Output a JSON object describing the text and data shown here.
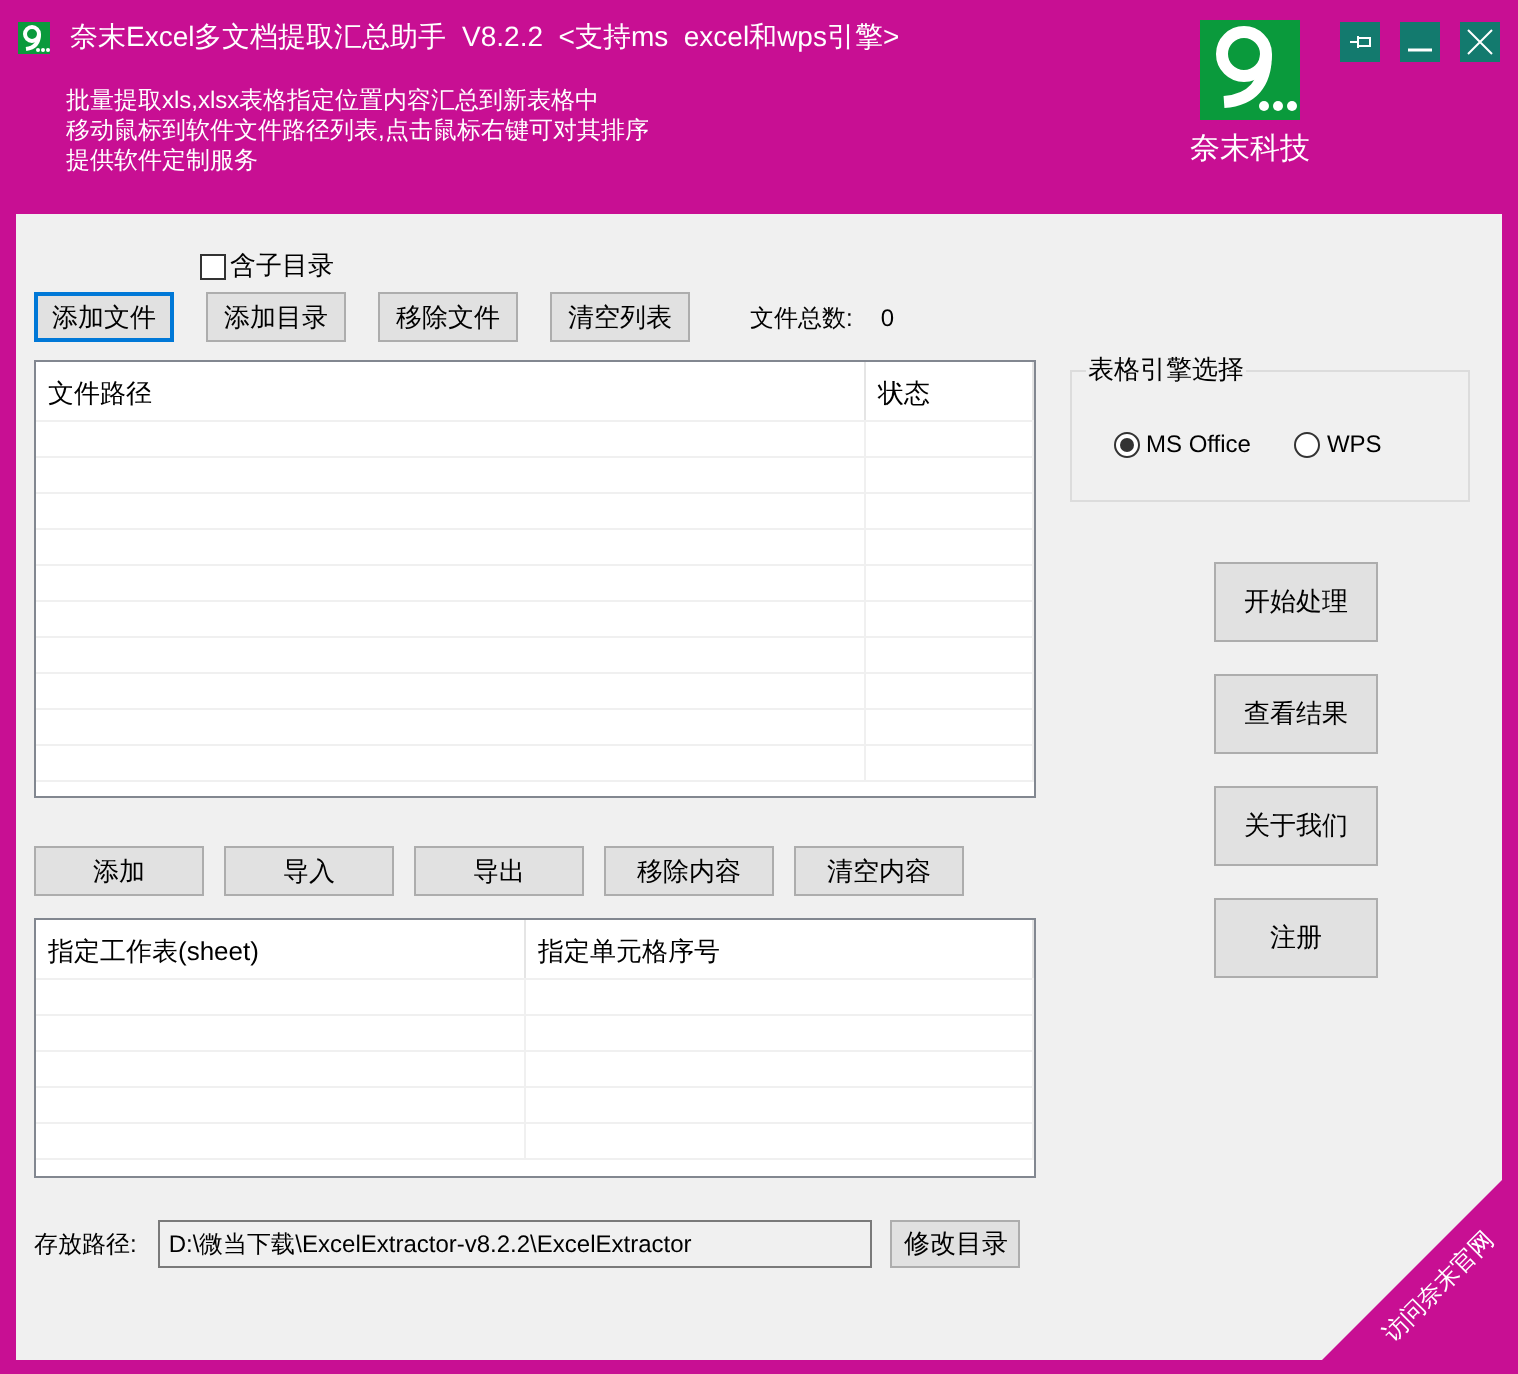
{
  "window": {
    "title": "奈末Excel多文档提取汇总助手  V8.2.2  <支持ms  excel和wps引擎>"
  },
  "header": {
    "lines": [
      "批量提取xls,xlsx表格指定位置内容汇总到新表格中",
      "移动鼠标到软件文件路径列表,点击鼠标右键可对其排序",
      "提供软件定制服务"
    ],
    "logo_caption": "奈末科技"
  },
  "include_subdirs": {
    "label": "含子目录",
    "checked": false
  },
  "file_buttons": [
    {
      "label": "添加文件",
      "focused": true
    },
    {
      "label": "添加目录",
      "focused": false
    },
    {
      "label": "移除文件",
      "focused": false
    },
    {
      "label": "清空列表",
      "focused": false
    }
  ],
  "file_count": {
    "label": "文件总数:",
    "value": "0"
  },
  "file_table": {
    "columns": [
      "文件路径",
      "状态"
    ]
  },
  "engine": {
    "title": "表格引擎选择",
    "options": [
      {
        "label": "MS Office",
        "selected": true
      },
      {
        "label": "WPS",
        "selected": false
      }
    ]
  },
  "action_buttons": [
    "开始处理",
    "查看结果",
    "关于我们",
    "注册"
  ],
  "sheet_buttons": [
    "添加",
    "导入",
    "导出",
    "移除内容",
    "清空内容"
  ],
  "sheet_table": {
    "columns": [
      "指定工作表(sheet)",
      "指定单元格序号"
    ]
  },
  "save_path": {
    "label": "存放路径:",
    "value": "D:\\微当下载\\ExcelExtractor-v8.2.2\\ExcelExtractor",
    "button": "修改目录"
  },
  "corner_link": "访问奈末官网"
}
